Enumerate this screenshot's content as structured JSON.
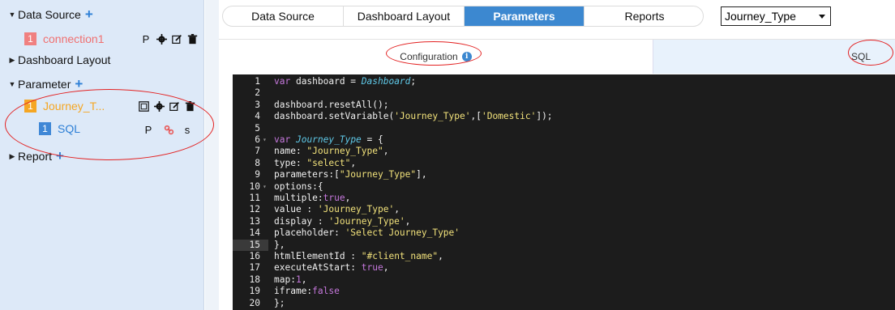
{
  "sidebar": {
    "data_source": {
      "label": "Data Source"
    },
    "connection": {
      "badge": "1",
      "label": "connection1",
      "p": "P"
    },
    "dashboard_layout": {
      "label": "Dashboard Layout"
    },
    "parameter": {
      "label": "Parameter"
    },
    "journey": {
      "badge": "1",
      "label": "Journey_T..."
    },
    "sql": {
      "badge": "1",
      "label": "SQL",
      "p": "P",
      "s": "s"
    },
    "report": {
      "label": "Report"
    }
  },
  "tabs": [
    "Data Source",
    "Dashboard Layout",
    "Parameters",
    "Reports"
  ],
  "active_tab": "Parameters",
  "select": {
    "value": "Journey_Type"
  },
  "subtabs": {
    "configuration": "Configuration",
    "sql": "SQL"
  },
  "editor": {
    "current_line": 15,
    "lines": [
      "var dashboard = Dashboard;",
      "",
      "dashboard.resetAll();",
      "dashboard.setVariable('Journey_Type',['Domestic']);",
      "",
      "var Journey_Type = {",
      "name: \"Journey_Type\",",
      "type: \"select\",",
      "parameters:[\"Journey_Type\"],",
      "options:{",
      "multiple:true,",
      "value : 'Journey_Type',",
      "display : 'Journey_Type',",
      "placeholder: 'Select Journey_Type'",
      "},",
      "htmlElementId : \"#client_name\",",
      "executeAtStart: true,",
      "map:1,",
      "iframe:false",
      "};"
    ]
  },
  "colors": {
    "accent": "#3c88d0",
    "sidebar_bg": "#dde9f8",
    "annotation": "#e32222"
  }
}
